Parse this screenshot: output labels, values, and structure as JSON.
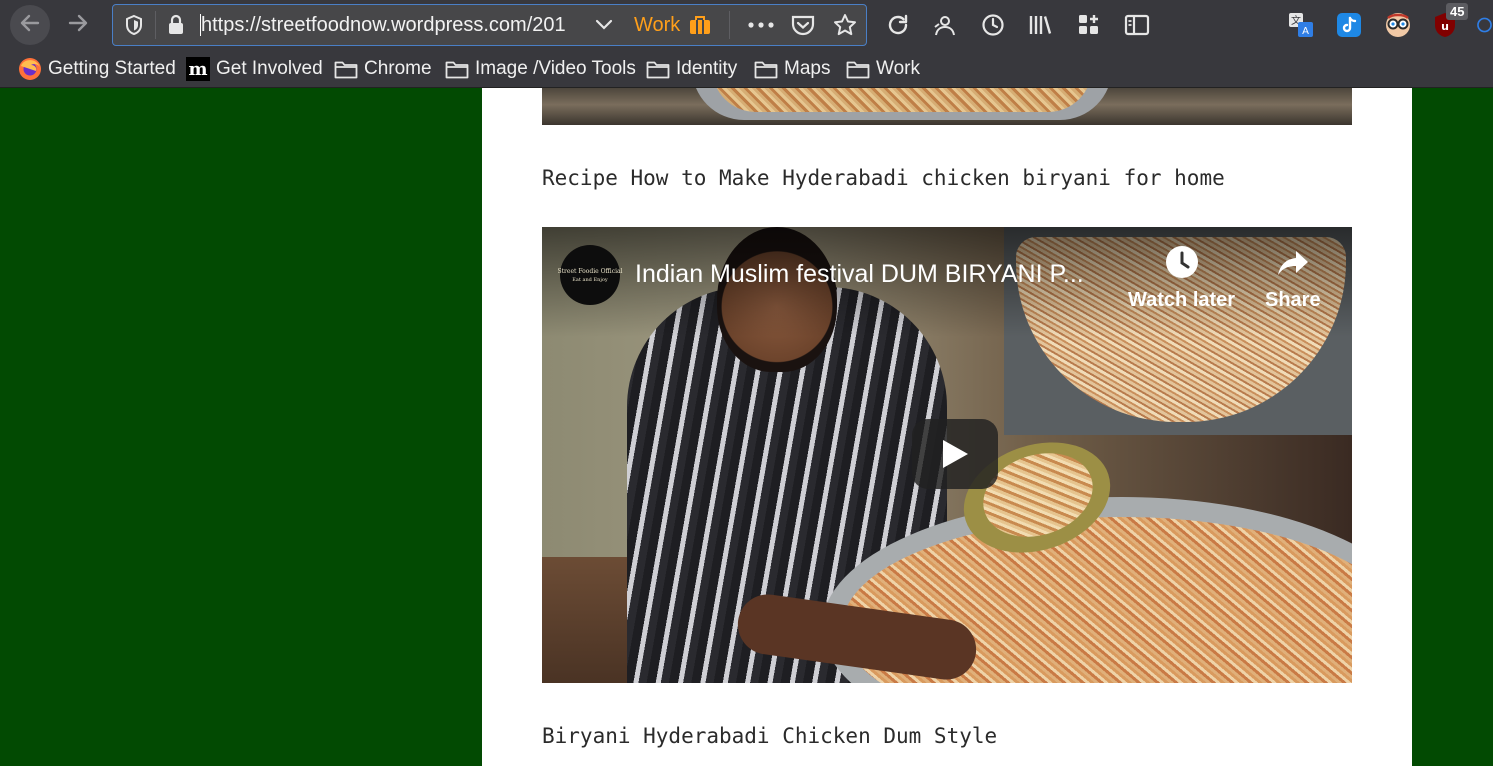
{
  "browser": {
    "url": "https://streetfoodnow.wordpress.com/201",
    "container_label": "Work",
    "extension_badge": "45",
    "icons": [
      "back-arrow-icon",
      "forward-arrow-icon",
      "shield-icon",
      "lock-icon",
      "chevron-down-icon",
      "briefcase-icon",
      "more-icon",
      "pocket-icon",
      "star-icon",
      "reload-icon",
      "reader-icon",
      "history-icon",
      "library-icon",
      "extensions-icon",
      "sidebar-icon",
      "translate-icon",
      "tiktok-icon",
      "glasses-icon",
      "ublock-icon"
    ],
    "accent_color": "#ff9f1a"
  },
  "bookmarks": [
    {
      "label": "Getting Started",
      "icon": "firefox-icon"
    },
    {
      "label": "Get Involved",
      "icon": "mozilla-icon"
    },
    {
      "label": "Chrome",
      "icon": "folder-icon"
    },
    {
      "label": "Image /Video Tools",
      "icon": "folder-icon"
    },
    {
      "label": "Identity",
      "icon": "folder-icon"
    },
    {
      "label": "Maps",
      "icon": "folder-icon"
    },
    {
      "label": "Work",
      "icon": "folder-icon"
    }
  ],
  "page": {
    "background_color": "#024a02",
    "caption_1": "Recipe How to Make Hyderabadi chicken biryani for home",
    "caption_2": "Biryani Hyderabadi Chicken Dum Style",
    "video": {
      "title": "Indian Muslim festival DUM BIRYANI P...",
      "channel_line_1": "Street Foodie Official",
      "channel_line_2": "Eat and Enjoy",
      "watch_later_label": "Watch later",
      "share_label": "Share"
    }
  }
}
